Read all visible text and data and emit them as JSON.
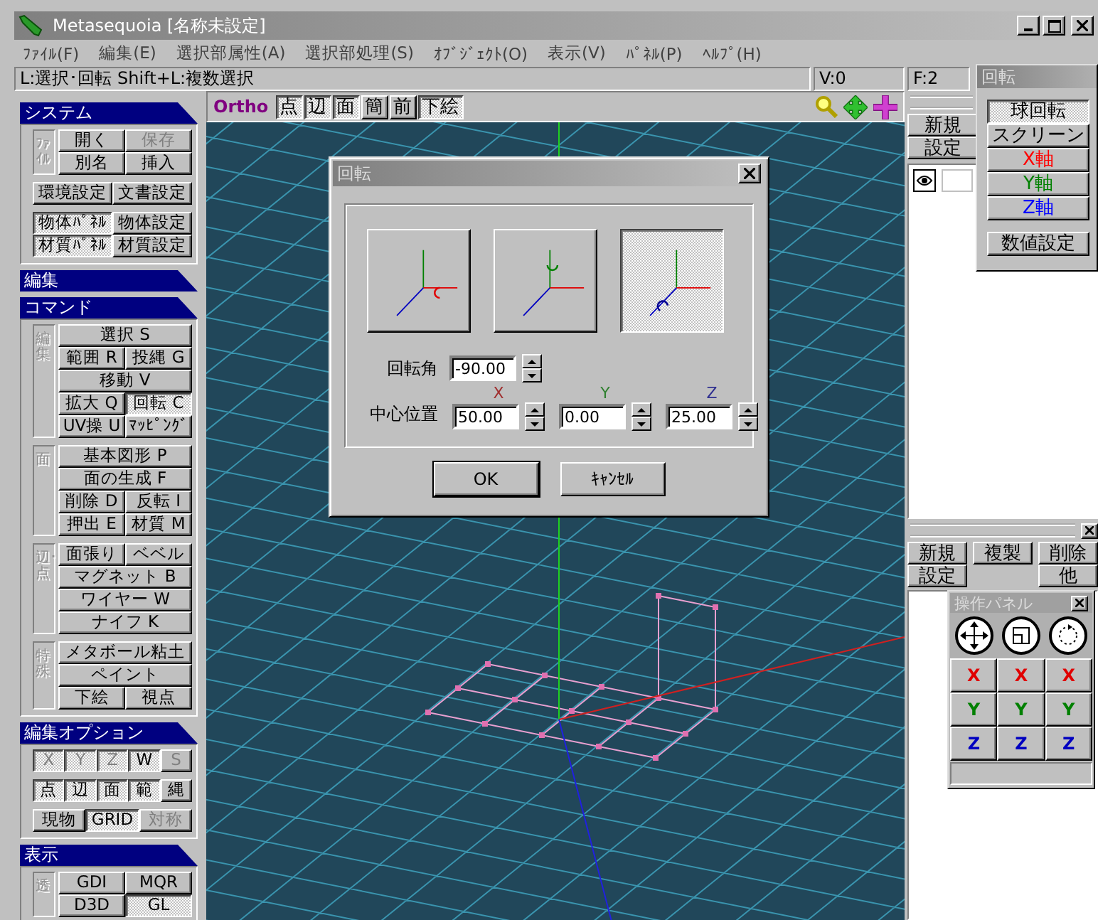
{
  "window": {
    "title": "Metasequoia [名称未設定]"
  },
  "menu": [
    "ﾌｧｲﾙ(F)",
    "編集(E)",
    "選択部属性(A)",
    "選択部処理(S)",
    "ｵﾌﾞｼﾞｪｸﾄ(O)",
    "表示(V)",
    "ﾊﾟﾈﾙ(P)",
    "ﾍﾙﾌﾟ(H)"
  ],
  "status_bar": {
    "hint": "L:選択･回転  Shift+L:複数選択",
    "vertex_count": "V:0",
    "face_count": "F:2"
  },
  "left_panel": {
    "sections": [
      {
        "title": "システム",
        "groups": [
          {
            "label": "ﾌｧｲﾙ",
            "rows": [
              [
                {
                  "label": "開く",
                  "selected": false,
                  "disabled": false
                },
                {
                  "label": "保存",
                  "selected": false,
                  "disabled": true
                }
              ],
              [
                {
                  "label": "別名",
                  "selected": false,
                  "disabled": false
                },
                {
                  "label": "挿入",
                  "selected": false,
                  "disabled": false
                }
              ]
            ]
          },
          {
            "rows": [
              [
                {
                  "label": "環境設定",
                  "selected": false,
                  "disabled": false
                },
                {
                  "label": "文書設定",
                  "selected": false,
                  "disabled": false
                }
              ]
            ]
          },
          {
            "rows": [
              [
                {
                  "label": "物体ﾊﾟﾈﾙ",
                  "selected": true,
                  "disabled": false
                },
                {
                  "label": "物体設定",
                  "selected": false,
                  "disabled": false
                }
              ],
              [
                {
                  "label": "材質ﾊﾟﾈﾙ",
                  "selected": true,
                  "disabled": false
                },
                {
                  "label": "材質設定",
                  "selected": false,
                  "disabled": false
                }
              ]
            ]
          }
        ]
      },
      {
        "title": "編集"
      },
      {
        "title": "コマンド",
        "groups": [
          {
            "label": "編集",
            "rows": [
              [
                {
                  "label": "選択 S",
                  "selected": false,
                  "disabled": false
                }
              ],
              [
                {
                  "label": "範囲 R",
                  "selected": false,
                  "disabled": false
                },
                {
                  "label": "投縄 G",
                  "selected": false,
                  "disabled": false
                }
              ],
              [
                {
                  "label": "移動 V",
                  "selected": false,
                  "disabled": false
                }
              ],
              [
                {
                  "label": "拡大 Q",
                  "selected": false,
                  "disabled": false
                },
                {
                  "label": "回転 C",
                  "selected": true,
                  "disabled": false
                }
              ],
              [
                {
                  "label": "UV操 U",
                  "selected": false,
                  "disabled": false
                },
                {
                  "label": "ﾏｯﾋﾟﾝｸﾞ",
                  "selected": false,
                  "disabled": false
                }
              ]
            ]
          },
          {
            "label": "面",
            "rows": [
              [
                {
                  "label": "基本図形 P",
                  "selected": false,
                  "disabled": false
                }
              ],
              [
                {
                  "label": "面の生成 F",
                  "selected": false,
                  "disabled": false
                }
              ],
              [
                {
                  "label": "削除 D",
                  "selected": false,
                  "disabled": false
                },
                {
                  "label": "反転 I",
                  "selected": false,
                  "disabled": false
                }
              ],
              [
                {
                  "label": "押出 E",
                  "selected": false,
                  "disabled": false
                },
                {
                  "label": "材質 M",
                  "selected": false,
                  "disabled": false
                }
              ]
            ]
          },
          {
            "label": "辺･点",
            "rows": [
              [
                {
                  "label": "面張り",
                  "selected": false,
                  "disabled": false
                },
                {
                  "label": "ベベル",
                  "selected": false,
                  "disabled": false
                }
              ],
              [
                {
                  "label": "マグネット B",
                  "selected": false,
                  "disabled": false
                }
              ],
              [
                {
                  "label": "ワイヤー W",
                  "selected": false,
                  "disabled": false
                }
              ],
              [
                {
                  "label": "ナイフ K",
                  "selected": false,
                  "disabled": false
                }
              ]
            ]
          },
          {
            "label": "特殊",
            "rows": [
              [
                {
                  "label": "メタボール粘土",
                  "selected": false,
                  "disabled": false
                }
              ],
              [
                {
                  "label": "ペイント",
                  "selected": false,
                  "disabled": false
                }
              ],
              [
                {
                  "label": "下絵",
                  "selected": false,
                  "disabled": false
                },
                {
                  "label": "視点",
                  "selected": false,
                  "disabled": false
                }
              ]
            ]
          }
        ]
      },
      {
        "title": "編集オプション",
        "groups": [
          {
            "rows": [
              [
                {
                  "label": "X",
                  "selected": true,
                  "disabled": true
                },
                {
                  "label": "Y",
                  "selected": true,
                  "disabled": true
                },
                {
                  "label": "Z",
                  "selected": true,
                  "disabled": true
                },
                {
                  "label": "W",
                  "selected": true,
                  "disabled": false
                },
                {
                  "label": "S",
                  "selected": false,
                  "disabled": true
                }
              ]
            ]
          },
          {
            "rows": [
              [
                {
                  "label": "点",
                  "selected": true,
                  "disabled": false
                },
                {
                  "label": "辺",
                  "selected": true,
                  "disabled": false
                },
                {
                  "label": "面",
                  "selected": true,
                  "disabled": false
                },
                {
                  "label": "範",
                  "selected": true,
                  "disabled": false
                },
                {
                  "label": "縄",
                  "selected": false,
                  "disabled": false
                }
              ]
            ]
          },
          {
            "rows": [
              [
                {
                  "label": "現物",
                  "selected": false,
                  "disabled": false
                },
                {
                  "label": "GRID",
                  "selected": true,
                  "disabled": false
                },
                {
                  "label": "対称",
                  "selected": false,
                  "disabled": true
                }
              ]
            ]
          }
        ]
      },
      {
        "title": "表示",
        "groups": [
          {
            "label": "透",
            "rows": [
              [
                {
                  "label": "GDI",
                  "selected": false,
                  "disabled": false
                },
                {
                  "label": "MQR",
                  "selected": false,
                  "disabled": false
                }
              ],
              [
                {
                  "label": "D3D",
                  "selected": false,
                  "disabled": false
                },
                {
                  "label": "GL",
                  "selected": true,
                  "disabled": false
                }
              ]
            ]
          }
        ]
      }
    ]
  },
  "viewport": {
    "mode": "Ortho",
    "buttons": [
      {
        "label": "点",
        "selected": true
      },
      {
        "label": "辺",
        "selected": true
      },
      {
        "label": "面",
        "selected": true
      },
      {
        "label": "簡",
        "selected": false
      },
      {
        "label": "前",
        "selected": false
      },
      {
        "label": "下絵",
        "selected": true
      }
    ]
  },
  "object_panel": {
    "buttons": [
      "新規",
      "設定"
    ],
    "objects": [
      {
        "visible": true
      }
    ]
  },
  "material_panel": {
    "buttons": [
      [
        "新規",
        "複製",
        "削除"
      ],
      [
        "設定",
        "他"
      ]
    ]
  },
  "rotate_panel": {
    "title": "回転",
    "buttons": [
      {
        "label": "球回転",
        "selected": true
      },
      {
        "label": "スクリーン",
        "selected": false
      },
      {
        "label": "X軸",
        "selected": false,
        "color": "#ff0000"
      },
      {
        "label": "Y軸",
        "selected": false,
        "color": "#008000"
      },
      {
        "label": "Z軸",
        "selected": false,
        "color": "#0000ff"
      }
    ],
    "settings_button": "数値設定"
  },
  "operation_panel": {
    "title": "操作パネル",
    "rows": [
      {
        "labels": [
          "X",
          "X",
          "X"
        ],
        "color": "#e00000"
      },
      {
        "labels": [
          "Y",
          "Y",
          "Y"
        ],
        "color": "#008000"
      },
      {
        "labels": [
          "Z",
          "Z",
          "Z"
        ],
        "color": "#0000c0"
      }
    ]
  },
  "dialog": {
    "title": "回転",
    "axis_buttons": [
      {
        "kind": "x",
        "selected": false
      },
      {
        "kind": "y",
        "selected": false
      },
      {
        "kind": "z",
        "selected": true
      }
    ],
    "angle": {
      "label": "回転角",
      "value": "-90.00"
    },
    "center": {
      "label": "中心位置",
      "fields": [
        {
          "axis_label": "X",
          "color": "#a03030",
          "value": "50.00"
        },
        {
          "axis_label": "Y",
          "color": "#308030",
          "value": "0.00"
        },
        {
          "axis_label": "Z",
          "color": "#303090",
          "value": "25.00"
        }
      ]
    },
    "buttons": [
      "OK",
      "ｷｬﾝｾﾙ"
    ]
  }
}
